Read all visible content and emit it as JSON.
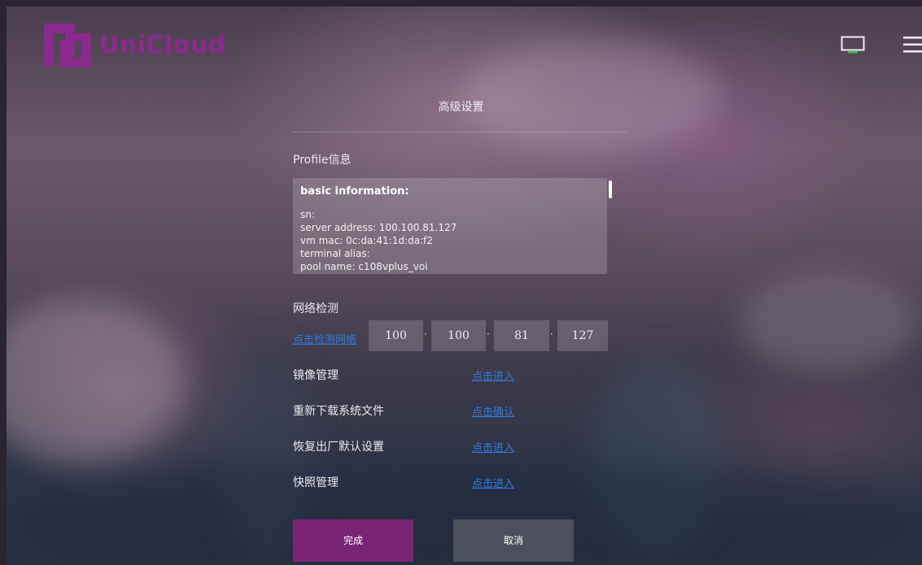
{
  "brand": {
    "name": "UniCloud",
    "color": "#8a2a8e"
  },
  "header_icons": {
    "display": "monitor-icon",
    "menu": "menu-icon"
  },
  "page": {
    "title": "高级设置"
  },
  "profile": {
    "label": "Profile信息",
    "heading": "basic information:",
    "lines": [
      "sn:",
      "server address: 100.100.81.127",
      "vm mac: 0c:da:41:1d:da:f2",
      "terminal alias:",
      "pool name: c108vplus_voi"
    ]
  },
  "network": {
    "label": "网络检测",
    "check_link": "点击检测网络",
    "ip": [
      "100",
      "100",
      "81",
      "127"
    ],
    "separator": "·"
  },
  "settings": [
    {
      "label": "镜像管理",
      "link": "点击进入"
    },
    {
      "label": "重新下载系统文件",
      "link": "点击确认"
    },
    {
      "label": "恢复出厂默认设置",
      "link": "点击进入"
    },
    {
      "label": "快照管理",
      "link": "点击进入"
    }
  ],
  "buttons": {
    "ok": "完成",
    "cancel": "取消"
  },
  "colors": {
    "accent": "#7a2478",
    "link": "#2f7be0"
  }
}
